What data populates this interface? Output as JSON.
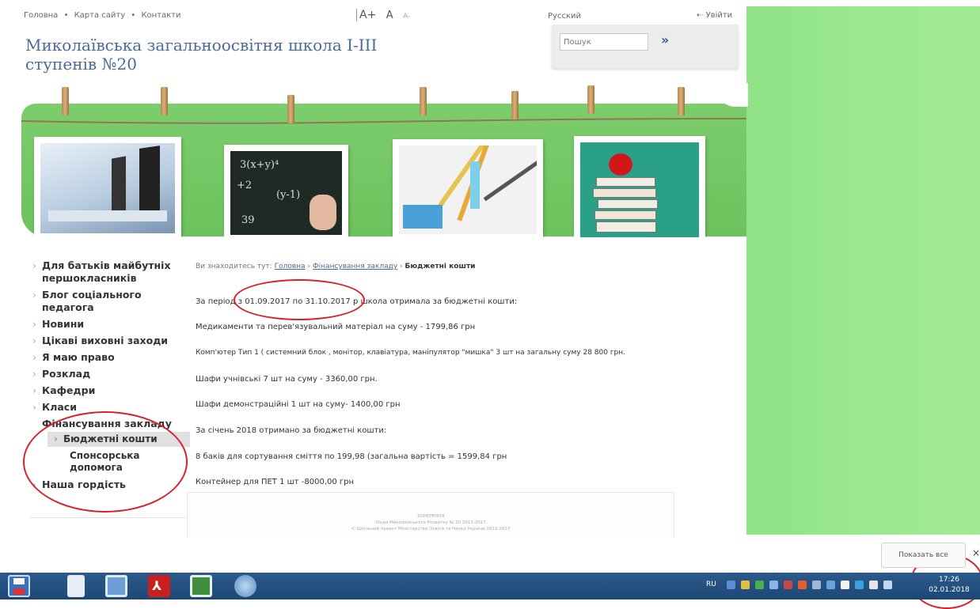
{
  "header": {
    "top_links": [
      "Головна",
      "Карта сайту",
      "Контакти"
    ],
    "separator": "•",
    "font_increase": "A+",
    "font_normal": "A",
    "font_decrease": "A-",
    "language": "Русский",
    "login": "Увійти",
    "site_title": "Миколаївська загальноосвітня школа I-III ступенів №20",
    "search_placeholder": "Пошук",
    "search_button": "»"
  },
  "sidebar": {
    "items": [
      "Для батьків майбутніх першокласників",
      "Блог соціального педагога",
      "Новини",
      "Цікаві виховні заходи",
      "Я маю право",
      "Розклад",
      "Кафедри",
      "Класи",
      "Фінансування закладу"
    ],
    "sub_items": [
      "Бюджетні кошти",
      "Спонсорська допомога"
    ],
    "last_item": "Наша гордість"
  },
  "breadcrumb": {
    "prefix": "Ви знаходитесь тут:",
    "home": "Головна",
    "section": "Фінансування закладу",
    "current": "Бюджетні кошти",
    "sep": "›"
  },
  "content": {
    "p1": "За період з 01.09.2017 по 31.10.2017 р школа отримала за бюджетні кошти:",
    "p2": "Медикаменти та перев'язувальний матеріал на суму - 1799,86 грн",
    "p3": "Комп'ютер Тип 1 ( системний блок , монітор, клавіатура, маніпулятор \"мишка\" 3 шт на загальну суму 28 800 грн.",
    "p4": "Шафи учнівські 7 шт на суму - 3360,00 грн.",
    "p5": "Шафи демонстраційні 1 шт на суму- 1400,00 грн",
    "p6": "За січень 2018 отримано за бюджетні кошти:",
    "p7": "8 баків для сортування сміття по 199,98 (загальна вартість = 1599,84 грн",
    "p8": "Контейнер для ПЕТ 1 шт -8000,00 грн"
  },
  "footer": {
    "line1": "ЗОНЕРЕННЯ",
    "line2": "Ліцея Миколаївського Розвитку № 20 2013-2017",
    "line3": "© Шкільний проект Міністерства Освіти та Науки України 2013-2017"
  },
  "download_bar": {
    "show_all": "Показать все",
    "close": "×"
  },
  "taskbar": {
    "lang": "RU",
    "time": "17:26",
    "date": "02.01.2018"
  },
  "colors": {
    "green_banner": "#6cc25d",
    "green_side": "#9ae88f",
    "title_blue": "#4a6a9a",
    "annotation_red": "#d6232c",
    "taskbar_blue": "#1e4775"
  }
}
